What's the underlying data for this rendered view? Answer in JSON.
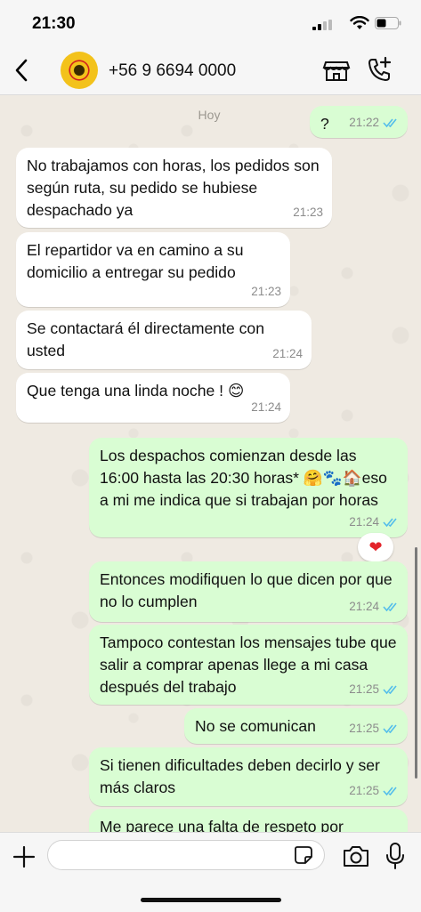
{
  "status_bar": {
    "time": "21:30"
  },
  "header": {
    "back_icon": "chevron-left-icon",
    "contact_name": "+56 9 6694 0000",
    "shop_icon": "storefront-icon",
    "call_icon": "phone-plus-icon"
  },
  "chat": {
    "day_separator": "Hoy",
    "messages": [
      {
        "dir": "out",
        "text": "?",
        "time": "21:22",
        "read": true
      },
      {
        "dir": "in",
        "text": "No trabajamos con horas, los pedidos son según ruta, su pedido se hubiese despachado ya",
        "time": "21:23"
      },
      {
        "dir": "in",
        "text": "El repartidor va en camino a su domicilio a entregar su pedido",
        "time": "21:23"
      },
      {
        "dir": "in",
        "text": "Se contactará él directamente con usted",
        "time": "21:24"
      },
      {
        "dir": "in",
        "text": "Que tenga una linda noche ! 😊",
        "time": "21:24"
      },
      {
        "dir": "out",
        "text": "Los despachos comienzan desde las 16:00 hasta las 20:30 horas* 🤗🐾🏠eso a mi me indica que si trabajan por horas",
        "time": "21:24",
        "read": true,
        "reaction": "❤"
      },
      {
        "dir": "out",
        "text": "Entonces modifiquen lo que dicen por que no lo cumplen",
        "time": "21:24",
        "read": true
      },
      {
        "dir": "out",
        "text": "Tampoco contestan los mensajes tube que salir a comprar apenas llege a mi casa después del trabajo",
        "time": "21:25",
        "read": true
      },
      {
        "dir": "out",
        "text": "No se comunican",
        "time": "21:25",
        "read": true
      },
      {
        "dir": "out",
        "text": "Si tienen dificultades deben decirlo y ser más claros",
        "time": "21:25",
        "read": true
      },
      {
        "dir": "out",
        "text": "Me parece una falta de respeto por",
        "time": "",
        "read": false
      }
    ],
    "colors": {
      "incoming": "#ffffff",
      "outgoing": "#d9fdd3",
      "read_ticks": "#53bdeb"
    }
  },
  "composer": {
    "input_value": "",
    "plus_icon": "plus-icon",
    "sticker_icon": "sticker-icon",
    "camera_icon": "camera-icon",
    "mic_icon": "microphone-icon"
  }
}
